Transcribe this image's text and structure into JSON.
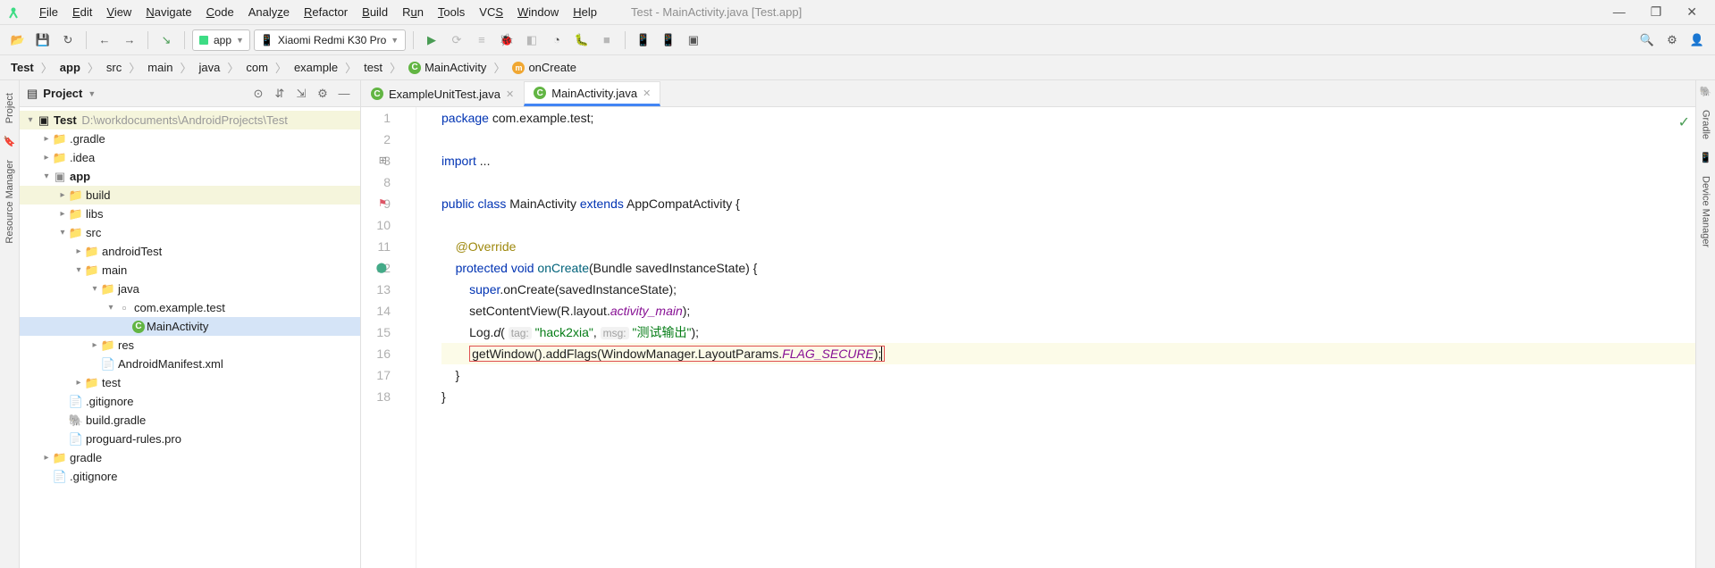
{
  "window_title": "Test - MainActivity.java [Test.app]",
  "menu": [
    "File",
    "Edit",
    "View",
    "Navigate",
    "Code",
    "Analyze",
    "Refactor",
    "Build",
    "Run",
    "Tools",
    "VCS",
    "Window",
    "Help"
  ],
  "run_config": {
    "module": "app",
    "device": "Xiaomi Redmi K30 Pro"
  },
  "breadcrumb": [
    "Test",
    "app",
    "src",
    "main",
    "java",
    "com",
    "example",
    "test",
    "MainActivity",
    "onCreate"
  ],
  "project_header": {
    "title": "Project"
  },
  "tree": {
    "root": {
      "name": "Test",
      "path": "D:\\workdocuments\\AndroidProjects\\Test"
    },
    "items": [
      {
        "d": 1,
        "t": "dir",
        "n": ".gradle",
        "c": "o"
      },
      {
        "d": 1,
        "t": "dir",
        "n": ".idea",
        "c": "o"
      },
      {
        "d": 1,
        "t": "mod",
        "n": "app",
        "bold": true,
        "open": true
      },
      {
        "d": 2,
        "t": "dir",
        "n": "build",
        "c": "o",
        "hl": true
      },
      {
        "d": 2,
        "t": "dir",
        "n": "libs"
      },
      {
        "d": 2,
        "t": "dir",
        "n": "src",
        "open": true
      },
      {
        "d": 3,
        "t": "dir",
        "n": "androidTest"
      },
      {
        "d": 3,
        "t": "dir",
        "n": "main",
        "open": true
      },
      {
        "d": 4,
        "t": "dir",
        "n": "java",
        "c": "b",
        "open": true
      },
      {
        "d": 5,
        "t": "pkg",
        "n": "com.example.test",
        "open": true
      },
      {
        "d": 6,
        "t": "cls",
        "n": "MainActivity",
        "sel": true
      },
      {
        "d": 4,
        "t": "dir",
        "n": "res"
      },
      {
        "d": 4,
        "t": "xml",
        "n": "AndroidManifest.xml"
      },
      {
        "d": 3,
        "t": "dir",
        "n": "test"
      },
      {
        "d": 2,
        "t": "f",
        "n": ".gitignore"
      },
      {
        "d": 2,
        "t": "gr",
        "n": "build.gradle"
      },
      {
        "d": 2,
        "t": "f",
        "n": "proguard-rules.pro"
      },
      {
        "d": 1,
        "t": "dir",
        "n": "gradle"
      },
      {
        "d": 1,
        "t": "f",
        "n": ".gitignore"
      }
    ]
  },
  "tabs": [
    {
      "name": "ExampleUnitTest.java",
      "active": false
    },
    {
      "name": "MainActivity.java",
      "active": true
    }
  ],
  "code": {
    "lines": [
      1,
      2,
      3,
      8,
      9,
      10,
      11,
      12,
      13,
      14,
      15,
      16,
      17,
      18
    ],
    "l1": "package com.example.test;",
    "l3_import": "import ...",
    "l9": "public class MainActivity extends AppCompatActivity {",
    "l11": "@Override",
    "l12": "protected void onCreate(Bundle savedInstanceState) {",
    "l13": "super.onCreate(savedInstanceState);",
    "l14_a": "setContentView(R.layout.",
    "l14_b": "activity_main",
    "l14_c": ");",
    "l15_a": "Log.",
    "l15_b": "d",
    "l15_c": "(",
    "l15_h1": "tag:",
    "l15_s1": "\"hack2xia\"",
    "l15_mid": ", ",
    "l15_h2": "msg:",
    "l15_s2": "\"测试输出\"",
    "l15_d": ");",
    "l16_a": "getWindow().addFlags(WindowManager.LayoutParams.",
    "l16_b": "FLAG_SECURE",
    "l16_c": ");"
  },
  "side_left": [
    "Project",
    "Resource Manager"
  ],
  "side_right": [
    "Gradle",
    "Device Manager"
  ]
}
